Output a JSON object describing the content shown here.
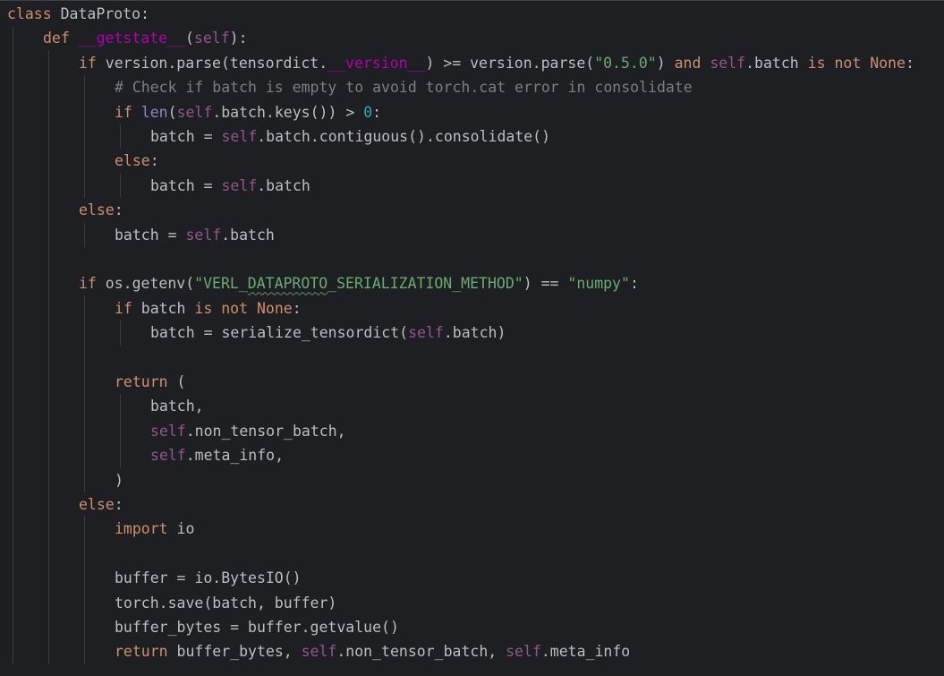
{
  "colors": {
    "background": "#1e1f22",
    "default": "#bcbec4",
    "keyword": "#cf8e6d",
    "self": "#94558d",
    "dunder": "#b200b2",
    "string": "#6aab73",
    "number": "#2aacb8",
    "comment": "#7a7e85",
    "builtin": "#8888c6"
  },
  "code": {
    "lines": [
      {
        "indent": 0,
        "tokens": [
          {
            "t": "class",
            "c": "keyword"
          },
          {
            "t": " DataProto:",
            "c": "default"
          }
        ]
      },
      {
        "indent": 1,
        "tokens": [
          {
            "t": "def",
            "c": "keyword"
          },
          {
            "t": " ",
            "c": "default"
          },
          {
            "t": "__getstate__",
            "c": "dunder-def"
          },
          {
            "t": "(",
            "c": "default"
          },
          {
            "t": "self",
            "c": "self"
          },
          {
            "t": "):",
            "c": "default"
          }
        ]
      },
      {
        "indent": 2,
        "tokens": [
          {
            "t": "if",
            "c": "keyword"
          },
          {
            "t": " version.parse(tensordict.",
            "c": "default"
          },
          {
            "t": "__version__",
            "c": "dunder"
          },
          {
            "t": ") >= version.parse(",
            "c": "default"
          },
          {
            "t": "\"0.5.0\"",
            "c": "string"
          },
          {
            "t": ") ",
            "c": "default"
          },
          {
            "t": "and",
            "c": "keyword"
          },
          {
            "t": " ",
            "c": "default"
          },
          {
            "t": "self",
            "c": "self"
          },
          {
            "t": ".batch ",
            "c": "default"
          },
          {
            "t": "is not None",
            "c": "keyword"
          },
          {
            "t": ":",
            "c": "default"
          }
        ]
      },
      {
        "indent": 3,
        "tokens": [
          {
            "t": "# Check if batch is empty to avoid torch.cat error in consolidate",
            "c": "comment"
          }
        ]
      },
      {
        "indent": 3,
        "tokens": [
          {
            "t": "if",
            "c": "keyword"
          },
          {
            "t": " ",
            "c": "default"
          },
          {
            "t": "len",
            "c": "builtin"
          },
          {
            "t": "(",
            "c": "default"
          },
          {
            "t": "self",
            "c": "self"
          },
          {
            "t": ".batch.keys()) > ",
            "c": "default"
          },
          {
            "t": "0",
            "c": "number"
          },
          {
            "t": ":",
            "c": "default"
          }
        ]
      },
      {
        "indent": 4,
        "tokens": [
          {
            "t": "batch = ",
            "c": "default"
          },
          {
            "t": "self",
            "c": "self"
          },
          {
            "t": ".batch.contiguous().consolidate()",
            "c": "default"
          }
        ]
      },
      {
        "indent": 3,
        "tokens": [
          {
            "t": "else",
            "c": "keyword"
          },
          {
            "t": ":",
            "c": "default"
          }
        ]
      },
      {
        "indent": 4,
        "tokens": [
          {
            "t": "batch = ",
            "c": "default"
          },
          {
            "t": "self",
            "c": "self"
          },
          {
            "t": ".batch",
            "c": "default"
          }
        ]
      },
      {
        "indent": 2,
        "tokens": [
          {
            "t": "else",
            "c": "keyword"
          },
          {
            "t": ":",
            "c": "default"
          }
        ]
      },
      {
        "indent": 3,
        "tokens": [
          {
            "t": "batch = ",
            "c": "default"
          },
          {
            "t": "self",
            "c": "self"
          },
          {
            "t": ".batch",
            "c": "default"
          }
        ]
      },
      {
        "indent": 0,
        "tokens": []
      },
      {
        "indent": 2,
        "tokens": [
          {
            "t": "if",
            "c": "keyword"
          },
          {
            "t": " os.getenv(",
            "c": "default"
          },
          {
            "t": "\"VERL_",
            "c": "string"
          },
          {
            "t": "DATAPROTO",
            "c": "string",
            "sq": true
          },
          {
            "t": "_SERIALIZATION_METHOD\"",
            "c": "string"
          },
          {
            "t": ") == ",
            "c": "default"
          },
          {
            "t": "\"numpy\"",
            "c": "string"
          },
          {
            "t": ":",
            "c": "default"
          }
        ]
      },
      {
        "indent": 3,
        "tokens": [
          {
            "t": "if",
            "c": "keyword"
          },
          {
            "t": " batch ",
            "c": "default"
          },
          {
            "t": "is not None",
            "c": "keyword"
          },
          {
            "t": ":",
            "c": "default"
          }
        ]
      },
      {
        "indent": 4,
        "tokens": [
          {
            "t": "batch = serialize_tensordict(",
            "c": "default"
          },
          {
            "t": "self",
            "c": "self"
          },
          {
            "t": ".batch)",
            "c": "default"
          }
        ]
      },
      {
        "indent": 0,
        "tokens": []
      },
      {
        "indent": 3,
        "tokens": [
          {
            "t": "return",
            "c": "keyword"
          },
          {
            "t": " (",
            "c": "default"
          }
        ]
      },
      {
        "indent": 4,
        "tokens": [
          {
            "t": "batch,",
            "c": "default"
          }
        ]
      },
      {
        "indent": 4,
        "tokens": [
          {
            "t": "self",
            "c": "self"
          },
          {
            "t": ".non_tensor_batch,",
            "c": "default"
          }
        ]
      },
      {
        "indent": 4,
        "tokens": [
          {
            "t": "self",
            "c": "self"
          },
          {
            "t": ".meta_info,",
            "c": "default"
          }
        ]
      },
      {
        "indent": 3,
        "tokens": [
          {
            "t": ")",
            "c": "default"
          }
        ]
      },
      {
        "indent": 2,
        "tokens": [
          {
            "t": "else",
            "c": "keyword"
          },
          {
            "t": ":",
            "c": "default"
          }
        ]
      },
      {
        "indent": 3,
        "tokens": [
          {
            "t": "import",
            "c": "keyword"
          },
          {
            "t": " io",
            "c": "default"
          }
        ]
      },
      {
        "indent": 0,
        "tokens": []
      },
      {
        "indent": 3,
        "tokens": [
          {
            "t": "buffer = io.BytesIO()",
            "c": "default"
          }
        ]
      },
      {
        "indent": 3,
        "tokens": [
          {
            "t": "torch.save(batch, buffer)",
            "c": "default"
          }
        ]
      },
      {
        "indent": 3,
        "tokens": [
          {
            "t": "buffer_bytes = buffer.getvalue()",
            "c": "default"
          }
        ]
      },
      {
        "indent": 3,
        "tokens": [
          {
            "t": "return",
            "c": "keyword"
          },
          {
            "t": " buffer_bytes, ",
            "c": "default"
          },
          {
            "t": "self",
            "c": "self"
          },
          {
            "t": ".non_tensor_batch, ",
            "c": "default"
          },
          {
            "t": "self",
            "c": "self"
          },
          {
            "t": ".meta_info",
            "c": "default"
          }
        ]
      }
    ]
  }
}
